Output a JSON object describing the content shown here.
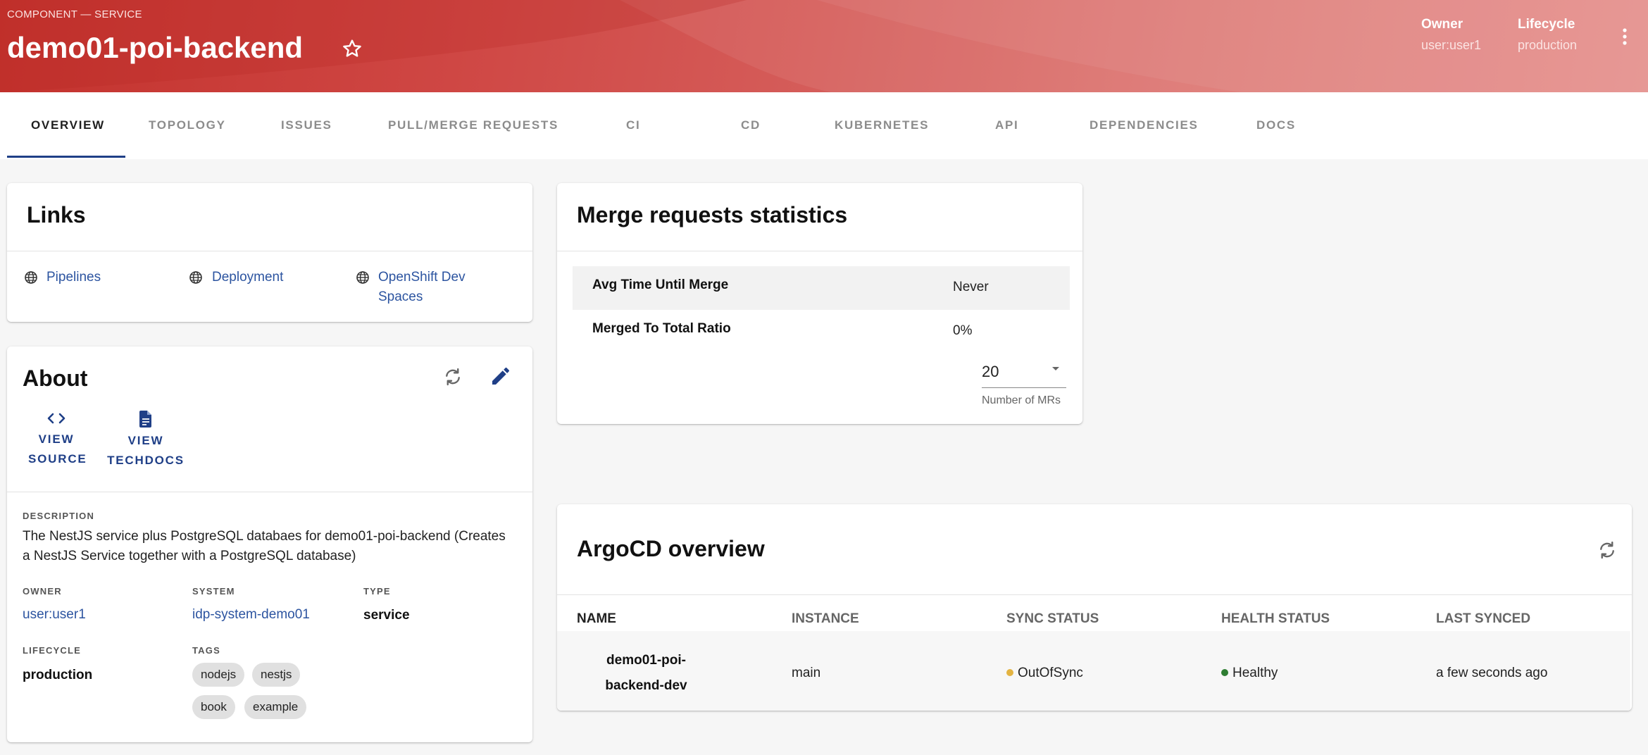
{
  "header": {
    "kind": "COMPONENT — SERVICE",
    "title": "demo01-poi-backend",
    "owner_label": "Owner",
    "owner_value": "user:user1",
    "lifecycle_label": "Lifecycle",
    "lifecycle_value": "production",
    "colors": {
      "start": "#c3322d",
      "end": "#e48a87"
    }
  },
  "tabs": [
    {
      "label": "OVERVIEW",
      "active": true
    },
    {
      "label": "TOPOLOGY"
    },
    {
      "label": "ISSUES"
    },
    {
      "label": "PULL/MERGE REQUESTS"
    },
    {
      "label": "CI"
    },
    {
      "label": "CD"
    },
    {
      "label": "KUBERNETES"
    },
    {
      "label": "API"
    },
    {
      "label": "DEPENDENCIES"
    },
    {
      "label": "DOCS"
    }
  ],
  "links_card": {
    "title": "Links",
    "items": [
      {
        "label": "Pipelines",
        "icon": "globe-icon"
      },
      {
        "label": "Deployment",
        "icon": "globe-icon"
      },
      {
        "label": "OpenShift Dev Spaces",
        "icon": "globe-icon"
      }
    ]
  },
  "about": {
    "title": "About",
    "view_source": "VIEW SOURCE",
    "view_techdocs": "VIEW TECHDOCS",
    "description_label": "DESCRIPTION",
    "description": "The NestJS service plus PostgreSQL databaes for demo01-poi-backend (Creates a NestJS Service together with a PostgreSQL database)",
    "owner_label": "OWNER",
    "owner": "user:user1",
    "system_label": "SYSTEM",
    "system": "idp-system-demo01",
    "type_label": "TYPE",
    "type": "service",
    "lifecycle_label": "LIFECYCLE",
    "lifecycle": "production",
    "tags_label": "TAGS",
    "tags": [
      "nodejs",
      "nestjs",
      "book",
      "example"
    ]
  },
  "merge_stats": {
    "title": "Merge requests statistics",
    "rows": [
      {
        "label": "Avg Time Until Merge",
        "value": "Never"
      },
      {
        "label": "Merged To Total Ratio",
        "value": "0%"
      }
    ],
    "count_value": "20",
    "count_helper": "Number of MRs"
  },
  "argocd": {
    "title": "ArgoCD overview",
    "columns": [
      "NAME",
      "INSTANCE",
      "SYNC STATUS",
      "HEALTH STATUS",
      "LAST SYNCED"
    ],
    "rows": [
      {
        "name": "demo01-poi-backend-dev",
        "instance": "main",
        "sync_status": "OutOfSync",
        "health_status": "Healthy",
        "last_synced": "a few seconds ago"
      }
    ],
    "status_colors": {
      "out_of_sync": "#e3b341",
      "healthy": "#2e7d32"
    }
  }
}
